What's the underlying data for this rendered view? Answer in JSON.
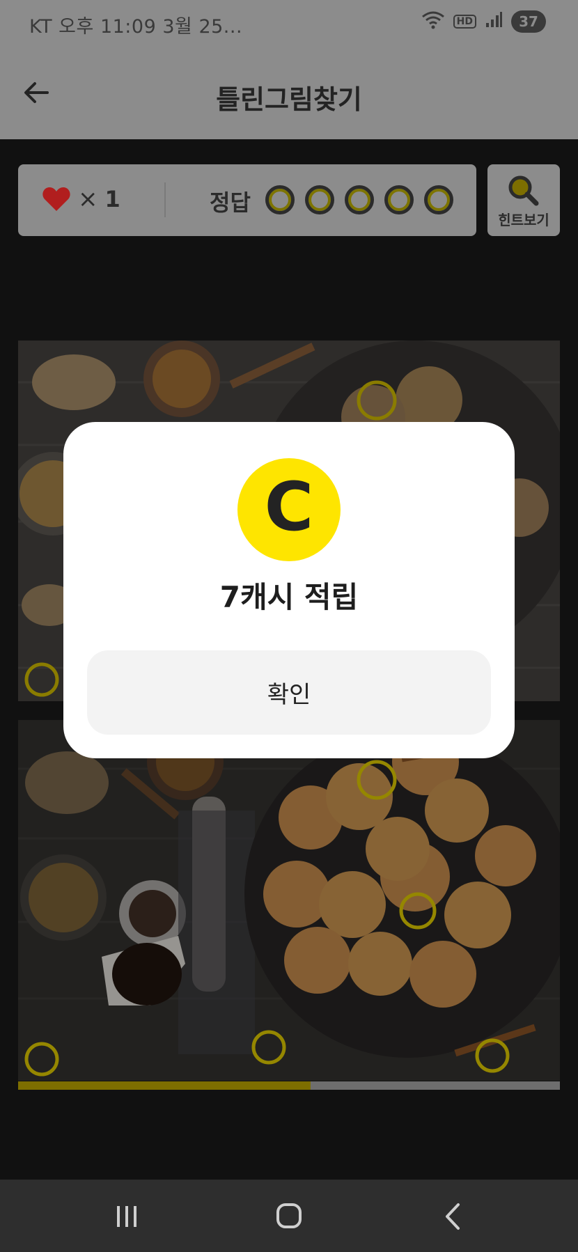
{
  "status_bar": {
    "left_text": "KT 오후 11:09  3월 25...",
    "wifi_icon": "wifi-icon",
    "hd_label": "HD",
    "signal_icon": "signal-icon",
    "battery_level": "37"
  },
  "header": {
    "back_icon": "arrow-left-icon",
    "title": "틀린그림찾기"
  },
  "score": {
    "heart_icon": "heart-icon",
    "times_sign": "×",
    "lives": "1",
    "answer_label": "정답",
    "answer_slots_total": 5,
    "answer_slots_found": 0
  },
  "hint": {
    "icon": "magnifier-icon",
    "label": "힌트보기"
  },
  "puzzle": {
    "progress": 0.54
  },
  "modal": {
    "coin_letter": "C",
    "coin_color": "#fee500",
    "reward_text": "7캐시 적립",
    "confirm_label": "확인"
  },
  "nav_bar": {
    "recents_icon": "recents-icon",
    "home_icon": "home-icon",
    "back_icon": "back-chevron-icon"
  },
  "colors": {
    "overlay_gray": "#8c8c8c",
    "accent_yellow": "#fee500",
    "heart_red": "#b11e1e"
  }
}
